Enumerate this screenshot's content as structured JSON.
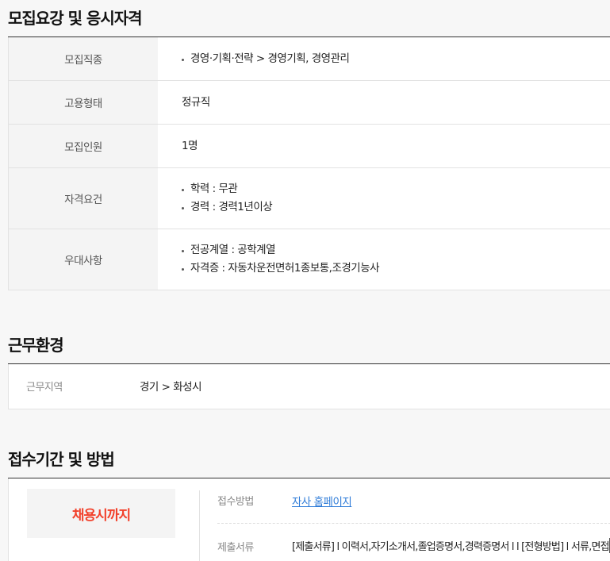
{
  "sections": {
    "recruit": {
      "title": "모집요강 및 응시자격",
      "rows": [
        {
          "label": "모집직종",
          "items": [
            "경영·기획·전략 > 경영기획, 경영관리"
          ]
        },
        {
          "label": "고용형태",
          "value": "정규직"
        },
        {
          "label": "모집인원",
          "value": "1명"
        },
        {
          "label": "자격요건",
          "items": [
            "학력 : 무관",
            "경력 : 경력1년이상"
          ]
        },
        {
          "label": "우대사항",
          "items": [
            "전공계열 : 공학계열",
            "자격증 : 자동차운전면허1종보통,조경기능사"
          ]
        }
      ]
    },
    "environment": {
      "title": "근무환경",
      "label": "근무지역",
      "value": "경기 > 화성시"
    },
    "apply": {
      "title": "접수기간 및 방법",
      "deadline": "채용시까지",
      "method_label": "접수방법",
      "method_value": "자사 홈페이지",
      "docs_label": "제출서류",
      "docs_value": "[제출서류] l 이력서,자기소개서,졸업증명서,경력증명서 l l [전형방법] l 서류,면접"
    }
  },
  "colors": {
    "deadline": "#f2412b",
    "link": "#2f7cd8"
  }
}
